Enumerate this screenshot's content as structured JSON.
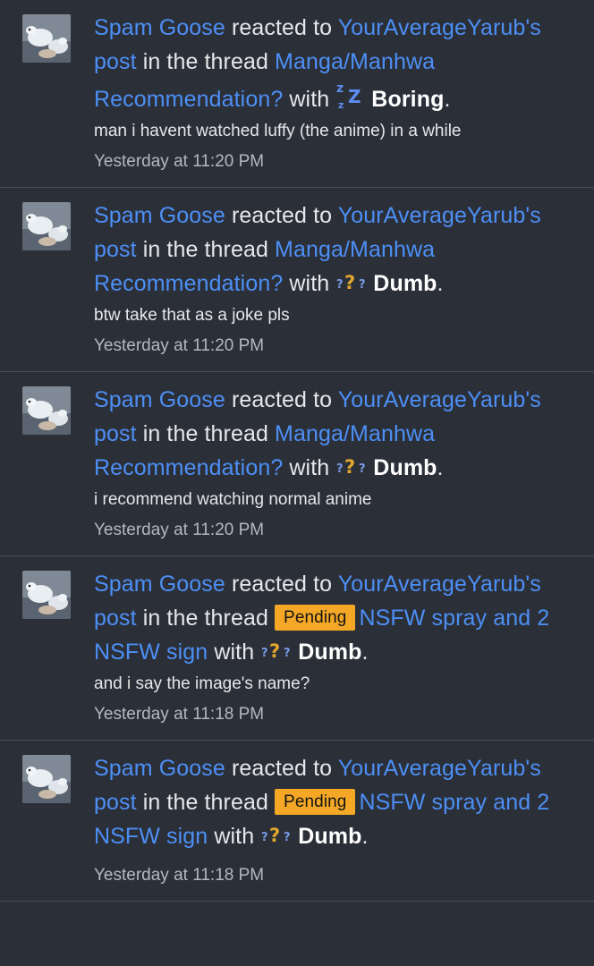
{
  "alerts": [
    {
      "user": "Spam Goose",
      "reacted_to": "reacted to",
      "poster": "YourAverageYarub's",
      "post": "post",
      "in_thread": "in the thread",
      "prefix": "",
      "thread": "Manga/Manhwa Recommendation?",
      "with": "with",
      "reaction_icon": "zzz-icon",
      "reaction": "Boring",
      "period": ".",
      "snippet": "man i havent watched luffy (the anime) in a while",
      "time": "Yesterday at 11:20 PM"
    },
    {
      "user": "Spam Goose",
      "reacted_to": "reacted to",
      "poster": "YourAverageYarub's",
      "post": "post",
      "in_thread": "in the thread",
      "prefix": "",
      "thread": "Manga/Manhwa Recommendation?",
      "with": "with",
      "reaction_icon": "question-marks-icon",
      "reaction": "Dumb",
      "period": ".",
      "snippet": "btw take that as a joke pls",
      "time": "Yesterday at 11:20 PM"
    },
    {
      "user": "Spam Goose",
      "reacted_to": "reacted to",
      "poster": "YourAverageYarub's",
      "post": "post",
      "in_thread": "in the thread",
      "prefix": "",
      "thread": "Manga/Manhwa Recommendation?",
      "with": "with",
      "reaction_icon": "question-marks-icon",
      "reaction": "Dumb",
      "period": ".",
      "snippet": "i recommend watching normal anime",
      "time": "Yesterday at 11:20 PM"
    },
    {
      "user": "Spam Goose",
      "reacted_to": "reacted to",
      "poster": "YourAverageYarub's",
      "post": "post",
      "in_thread": "in the thread",
      "prefix": "Pending",
      "thread": "NSFW spray and 2 NSFW sign",
      "with": "with",
      "reaction_icon": "question-marks-icon",
      "reaction": "Dumb",
      "period": ".",
      "snippet": "and i say the image's name?",
      "time": "Yesterday at 11:18 PM"
    },
    {
      "user": "Spam Goose",
      "reacted_to": "reacted to",
      "poster": "YourAverageYarub's",
      "post": "post",
      "in_thread": "in the thread",
      "prefix": "Pending",
      "thread": "NSFW spray and 2 NSFW sign",
      "with": "with",
      "reaction_icon": "question-marks-icon",
      "reaction": "Dumb",
      "period": ".",
      "snippet": "",
      "time": "Yesterday at 11:18 PM"
    }
  ],
  "colors": {
    "background": "#2b2f38",
    "link": "#4d8ff5",
    "text": "#e6e7ea",
    "muted": "#b4b8c0",
    "pending_badge": "#f4a825",
    "reaction_icon": "#5b8df0"
  }
}
